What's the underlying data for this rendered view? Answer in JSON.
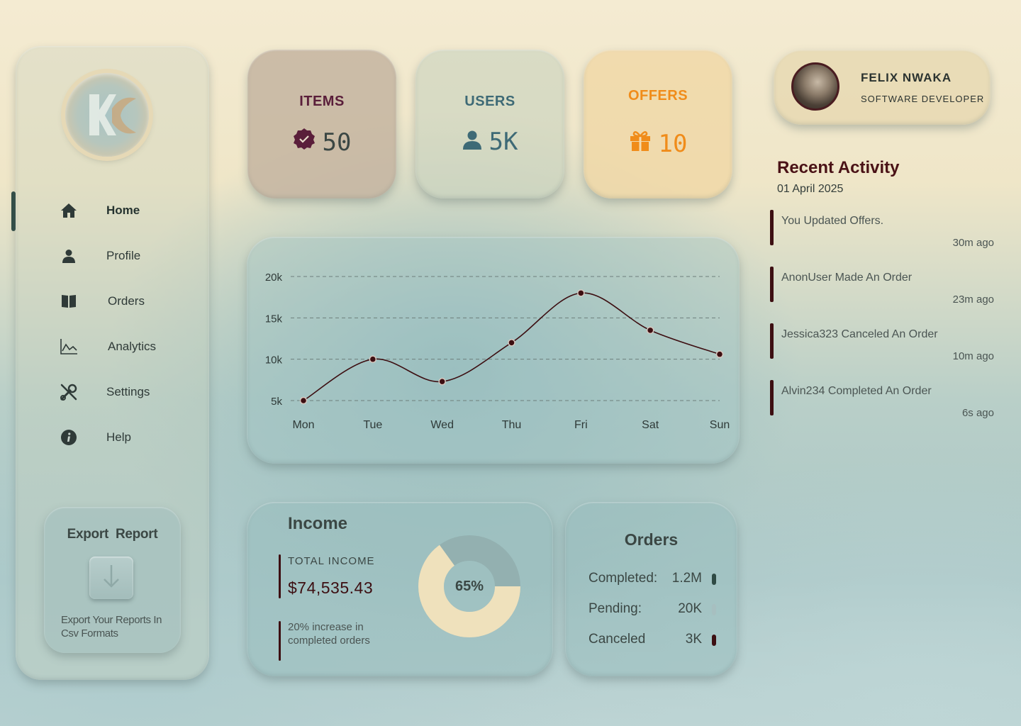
{
  "sidebar": {
    "items": [
      {
        "label": "Home",
        "icon": "home-icon",
        "active": true
      },
      {
        "label": "Profile",
        "icon": "user-icon"
      },
      {
        "label": "Orders",
        "icon": "book-icon"
      },
      {
        "label": "Analytics",
        "icon": "chart-line-icon"
      },
      {
        "label": "Settings",
        "icon": "tools-icon"
      },
      {
        "label": "Help",
        "icon": "info-icon"
      }
    ],
    "export": {
      "title": "Export  Report",
      "description": "Export Your Reports In Csv Formats"
    }
  },
  "stats": {
    "items": {
      "title": "ITEMS",
      "value": "50",
      "color": "#5a1e3a"
    },
    "users": {
      "title": "USERS",
      "value": "5K",
      "color": "#3e6a76"
    },
    "offers": {
      "title": "OFFERS",
      "value": "10",
      "color": "#f08c1a"
    }
  },
  "profile": {
    "name": "FELIX NWAKA",
    "role": "SOFTWARE DEVELOPER"
  },
  "activity": {
    "title": "Recent Activity",
    "date": "01 April 2025",
    "items": [
      {
        "text": "You Updated Offers.",
        "time": "30m ago"
      },
      {
        "text": "AnonUser Made An Order",
        "time": "23m ago"
      },
      {
        "text": "Jessica323 Canceled An Order",
        "time": "10m ago"
      },
      {
        "text": "Alvin234 Completed An Order",
        "time": "6s ago"
      }
    ]
  },
  "chart_data": {
    "type": "line",
    "categories": [
      "Mon",
      "Tue",
      "Wed",
      "Thu",
      "Fri",
      "Sat",
      "Sun"
    ],
    "series": [
      {
        "values": [
          5000,
          10000,
          7300,
          12000,
          18000,
          13500,
          10600
        ]
      }
    ],
    "yticks": [
      "5k",
      "10k",
      "15k",
      "20k"
    ],
    "ytick_values": [
      5000,
      10000,
      15000,
      20000
    ],
    "ylim": [
      5000,
      20000
    ],
    "grid": true,
    "line_color": "#3d0f12"
  },
  "income": {
    "title": "Income",
    "total_label": "TOTAL INCOME",
    "total_value": "$74,535.43",
    "description": "20% increase in completed orders",
    "donut_label": "65%",
    "donut_fraction": 0.65
  },
  "orders": {
    "title": "Orders",
    "rows": [
      {
        "label": "Completed:",
        "value": "1.2M",
        "color": "#2f4a44"
      },
      {
        "label": "Pending:",
        "value": "20K",
        "color": "#a7bfc0"
      },
      {
        "label": "Canceled",
        "value": "3K",
        "color": "#3d0f12"
      }
    ]
  }
}
